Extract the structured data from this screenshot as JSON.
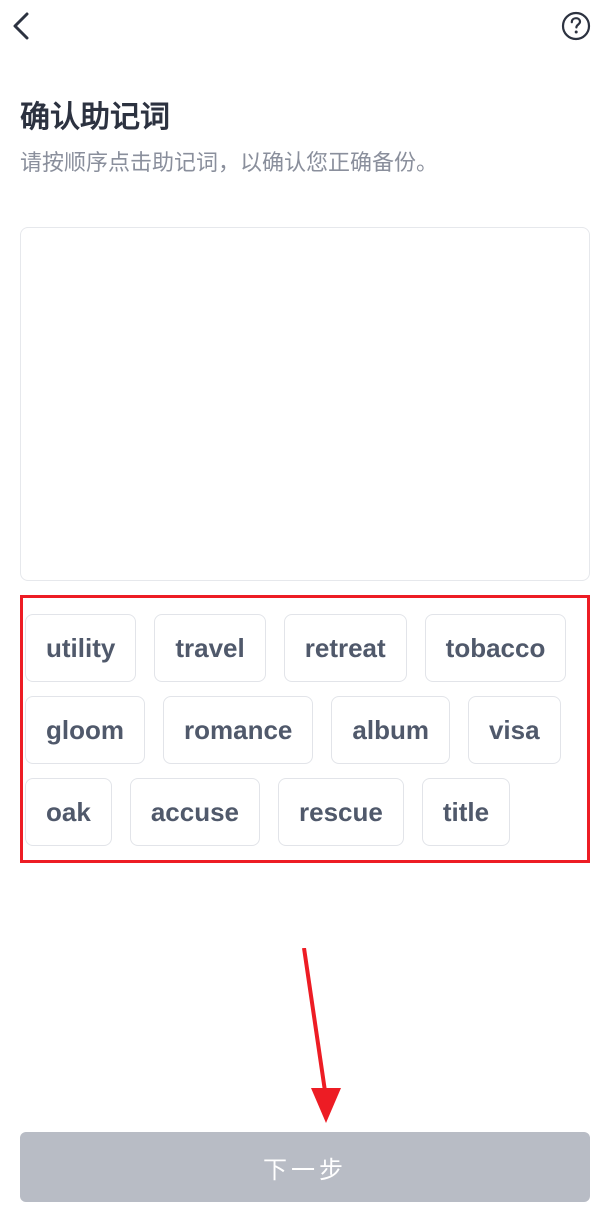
{
  "header": {
    "back_icon": "back",
    "help_icon": "help"
  },
  "page": {
    "title": "确认助记词",
    "subtitle": "请按顺序点击助记词，以确认您正确备份。"
  },
  "words": [
    "utility",
    "travel",
    "retreat",
    "tobacco",
    "gloom",
    "romance",
    "album",
    "visa",
    "oak",
    "accuse",
    "rescue",
    "title"
  ],
  "footer": {
    "next_label": "下一步"
  },
  "annotation": {
    "highlight_color": "#ed1c24"
  }
}
